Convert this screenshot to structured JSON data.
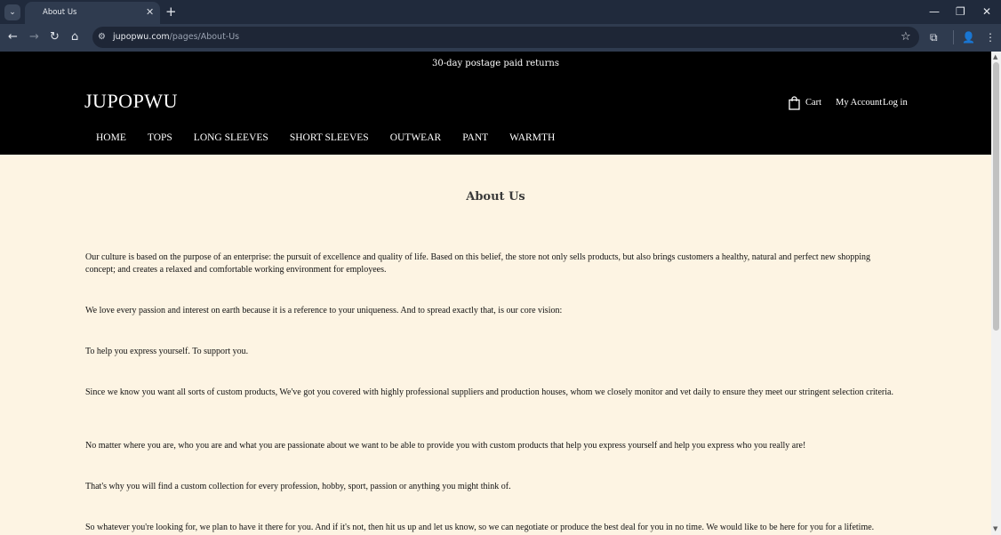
{
  "browser": {
    "tab_title": "About Us",
    "tab_close": "✕",
    "new_tab": "+",
    "tab_dropdown": "⌄",
    "url_domain": "jupopwu.com",
    "url_path": "/pages/About-Us",
    "win_minimize": "—",
    "win_restore": "❐",
    "win_close": "✕"
  },
  "header": {
    "announcement": "30-day postage paid returns",
    "logo": "JUPOPWU",
    "cart_label": "Cart",
    "account_label": "My Account",
    "login_label": "Log in"
  },
  "nav": {
    "items": [
      "HOME",
      "TOPS",
      "LONG SLEEVES",
      "SHORT SLEEVES",
      "OUTWEAR",
      "PANT",
      "WARMTH"
    ]
  },
  "page": {
    "title": "About Us",
    "paragraphs": [
      "Our culture is based on the purpose of an enterprise: the pursuit of excellence and quality of life. Based on this belief, the store not only sells products, but also brings customers a healthy, natural and perfect new shopping concept; and creates a relaxed and comfortable working environment for employees.",
      "We love every passion and interest on earth because it is a reference to your uniqueness. And to spread exactly that, is our core vision:",
      "To help you express yourself. To support you.",
      "Since we know you want all sorts of custom products, We've got you covered with highly professional suppliers and production houses, whom we closely monitor and vet daily to ensure they meet our stringent selection criteria.",
      "No matter where you are, who you are and what you are passionate about we want to be able to provide you with custom products that help you express yourself and help you express who you really are!",
      "That's why you will find a custom collection for every profession, hobby, sport, passion or anything you might think of.",
      "So whatever you're looking for, we plan to have it there for you. And if it's not, then hit us up and let us know, so we can negotiate or produce the best deal for you in no time. We would like to be here for you for a lifetime."
    ]
  }
}
